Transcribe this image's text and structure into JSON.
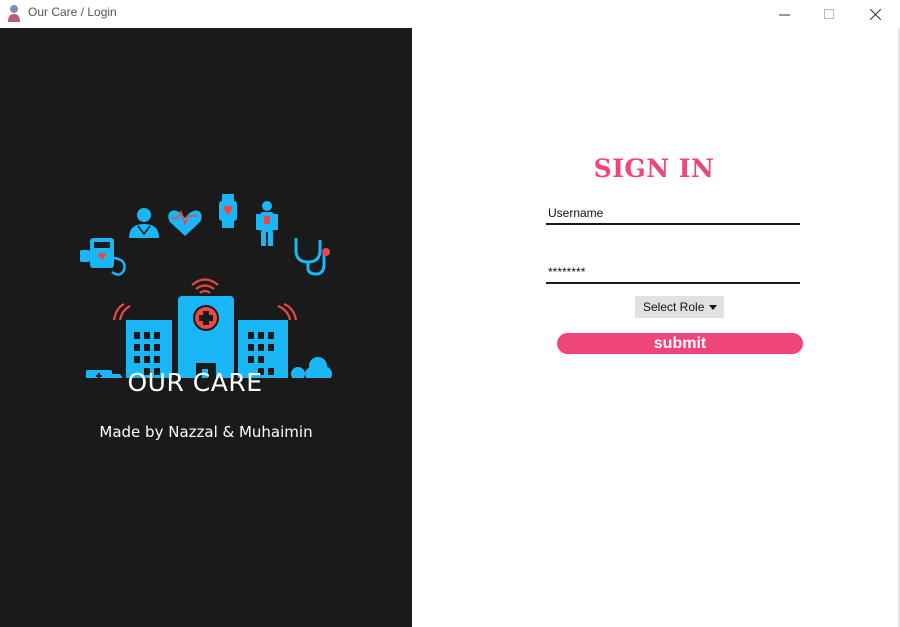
{
  "window": {
    "title": "Our Care / Login",
    "icon": "user-icon"
  },
  "brand": {
    "name": "OUR CARE",
    "credit": "Made by Nazzal & Muhaimin",
    "logo": "hospital-logo"
  },
  "form": {
    "heading": "SIGN IN",
    "username_value": "Username",
    "password_value": "********",
    "role_label": "Select Role",
    "submit_label": "submit"
  },
  "colors": {
    "accent": "#f0457a",
    "panel": "#1b1a1b",
    "icon_blue": "#1ab6f5",
    "icon_red": "#ea4747"
  }
}
